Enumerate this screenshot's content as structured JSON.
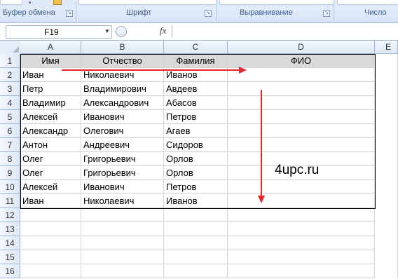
{
  "ribbon": {
    "groups": [
      {
        "label": "Буфер обмена"
      },
      {
        "label": "Шрифт"
      },
      {
        "label": "Выравнивание"
      },
      {
        "label": "Число"
      }
    ]
  },
  "formula_bar": {
    "name_box": "F19",
    "fx_label": "fx",
    "value": ""
  },
  "columns": [
    "A",
    "B",
    "C",
    "D"
  ],
  "rows": [
    "1",
    "2",
    "3",
    "4",
    "5",
    "6",
    "7",
    "8",
    "9",
    "10",
    "11",
    "12",
    "13",
    "14",
    "15",
    "16"
  ],
  "table": {
    "headers": [
      "Имя",
      "Отчество",
      "Фамилия",
      "ФИО"
    ],
    "data": [
      [
        "Иван",
        "Николаевич",
        "Иванов",
        ""
      ],
      [
        "Петр",
        "Владимирович",
        "Авдеев",
        ""
      ],
      [
        "Владимир",
        "Александрович",
        "Абасов",
        ""
      ],
      [
        "Алексей",
        "Иванович",
        "Петров",
        ""
      ],
      [
        "Александр",
        "Олегович",
        "Агаев",
        ""
      ],
      [
        "Антон",
        "Андреевич",
        "Сидоров",
        ""
      ],
      [
        "Олег",
        "Григорьевич",
        "Орлов",
        ""
      ],
      [
        "Олег",
        "Григорьевич",
        "Орлов",
        ""
      ],
      [
        "Алексей",
        "Иванович",
        "Петров",
        ""
      ],
      [
        "Иван",
        "Николаевич",
        "Иванов",
        ""
      ]
    ]
  },
  "watermark": "4upc.ru",
  "colors": {
    "arrow": "#e8262a",
    "header_fill": "#d9d9d9"
  }
}
